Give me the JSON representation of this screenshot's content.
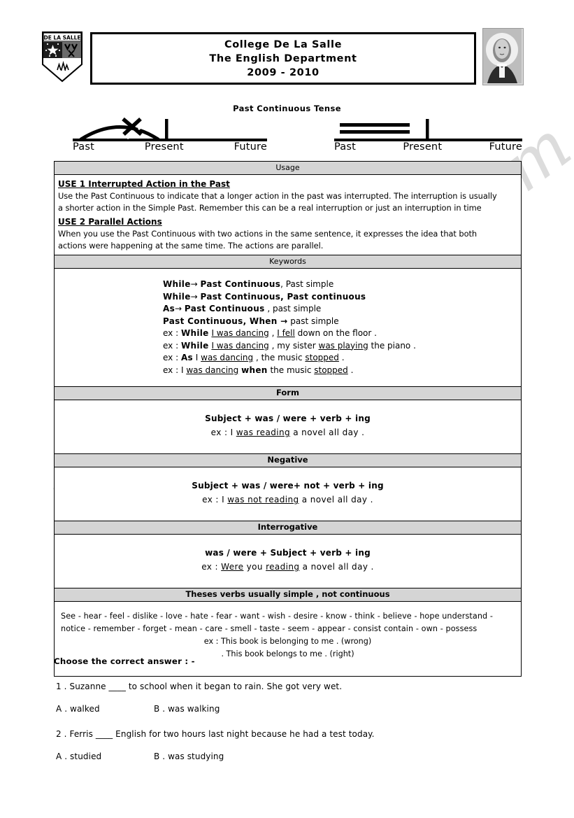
{
  "header": {
    "crest_label": "DE LA SALLE",
    "title_lines": [
      "College De La Salle",
      "The English Department",
      "2009 - 2010"
    ],
    "portrait_alt": "founder-portrait"
  },
  "tense_title": "Past Continuous Tense",
  "timelines": [
    {
      "name": "interrupted-action",
      "labels": [
        "Past",
        "Present",
        "Future"
      ]
    },
    {
      "name": "parallel-actions",
      "labels": [
        "Past",
        "Present",
        "Future"
      ]
    }
  ],
  "sections": {
    "usage": {
      "header": "Usage",
      "use1_title": "USE 1 Interrupted Action in the Past",
      "use1_text_line1": "Use the Past Continuous to indicate that a longer action in the past was interrupted. The interruption is usually",
      "use1_text_line2": "a shorter action in the Simple Past. Remember this can be a real interruption or just an interruption in time",
      "use2_title": "USE 2 Parallel Actions",
      "use2_text_line1": "When you use the Past Continuous with two actions in the same sentence, it expresses the idea that both",
      "use2_text_line2": "actions were happening at the same time. The actions are parallel."
    },
    "keywords": {
      "header": "Keywords",
      "lines": [
        {
          "bold1": "While",
          "arrow": "→",
          "bold2": "Past Continuous",
          "tail": ", Past simple",
          "tail_bold": false
        },
        {
          "bold1": "While",
          "arrow": "→",
          "bold2": "Past Continuous",
          "tail": ",  Past continuous",
          "tail_bold": true
        },
        {
          "bold1": "As",
          "arrow": "→",
          "bold2": "Past Continuous",
          "tail": " , past simple",
          "tail_bold": false
        },
        {
          "bold1": "Past Continuous",
          "arrow": "",
          "bold2": ", When →",
          "tail": " past simple",
          "tail_bold": false
        }
      ],
      "examples": [
        "ex : While I was dancing , I fell down on the floor .",
        "ex : While  I was dancing , my sister was playing the piano .",
        "ex : As I was dancing , the music stopped .",
        "ex : I was dancing when the music stopped ."
      ]
    },
    "form": {
      "header": "Form",
      "rule": "Subject + was / were + verb + ing",
      "example": "ex : I was reading a novel all day ."
    },
    "negative": {
      "header": "Negative",
      "rule": "Subject + was / were+ not + verb + ing",
      "example": "ex : I was not reading a novel all day ."
    },
    "interrogative": {
      "header": "Interrogative",
      "rule": "was / were + Subject  + verb + ing",
      "example": "ex : Were you reading a novel all day ."
    },
    "stative": {
      "header": "Theses verbs usually simple , not continuous",
      "verbs_line1": "See - hear - feel - dislike - love - hate - fear - want - wish - desire - know - think - believe - hope understand -",
      "verbs_line2": "notice - remember - forget - mean - care - smell - taste - seem - appear - consist  contain - own - possess",
      "example_wrong": "ex : This book is belonging to me . (wrong)",
      "example_right": ". This book belongs to me . (right)"
    }
  },
  "exercise": {
    "title": "Choose the correct answer : -",
    "questions": [
      {
        "text": "1 . Suzanne ____ to school when it began to rain. She got very wet.",
        "option_a": "A . walked",
        "option_b": "B .  was walking"
      },
      {
        "text": "2 . Ferris ____ English for two hours last night because he had a test today.",
        "option_a": "A . studied",
        "option_b": "B . was studying"
      }
    ]
  },
  "watermark": {
    "text": "ESLprintables.com"
  },
  "colors": {
    "section_header_bg": "#d5d5d5",
    "border": "#000000",
    "watermark": "#969696"
  }
}
